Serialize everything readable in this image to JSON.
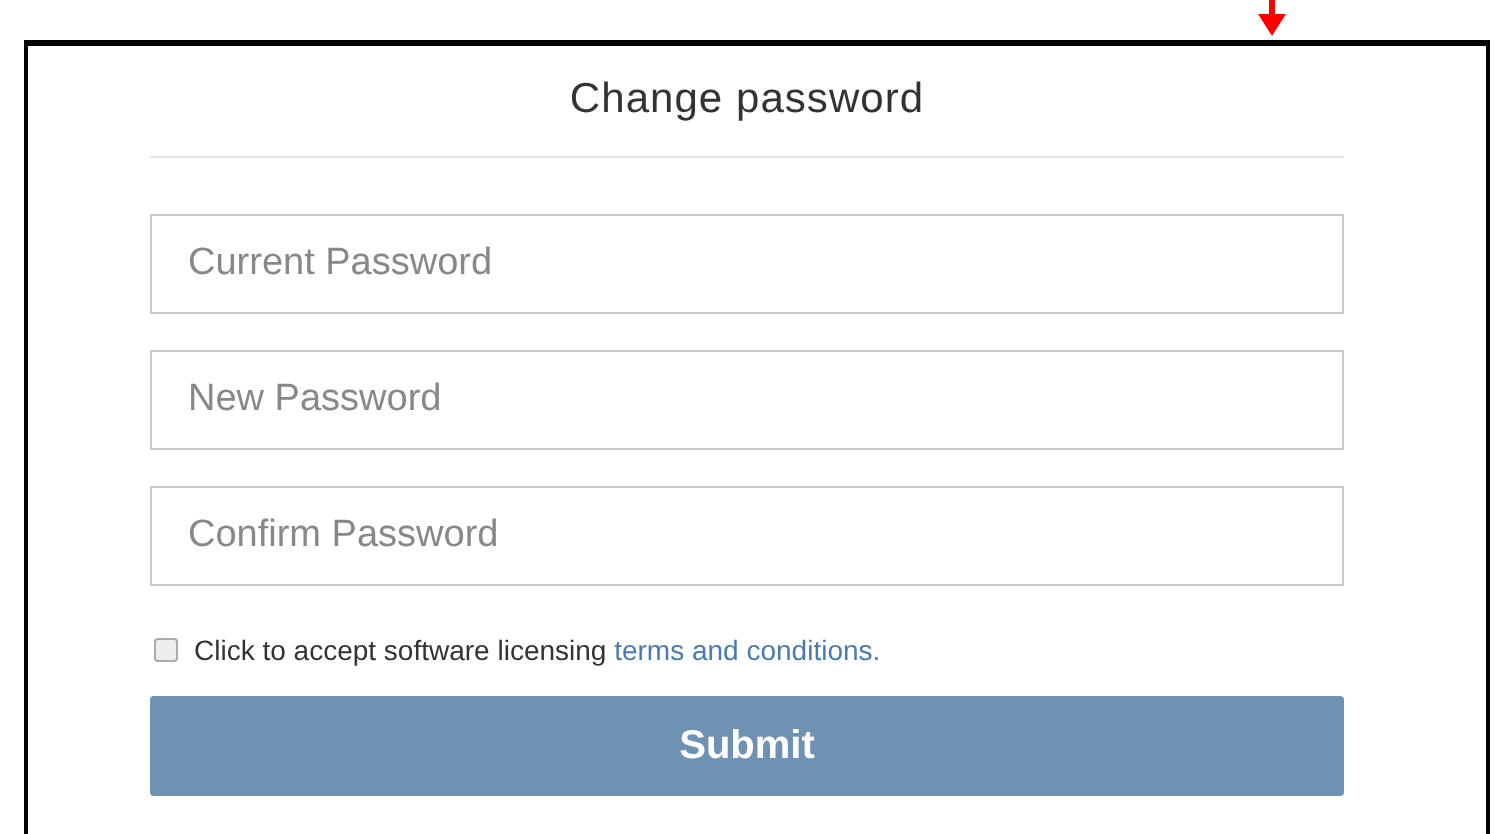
{
  "title": "Change password",
  "fields": [
    {
      "placeholder": "Current Password"
    },
    {
      "placeholder": "New Password"
    },
    {
      "placeholder": "Confirm Password"
    }
  ],
  "terms": {
    "checked": false,
    "text": "Click to accept software licensing",
    "link": "terms and conditions."
  },
  "submit": {
    "label": "Submit"
  }
}
